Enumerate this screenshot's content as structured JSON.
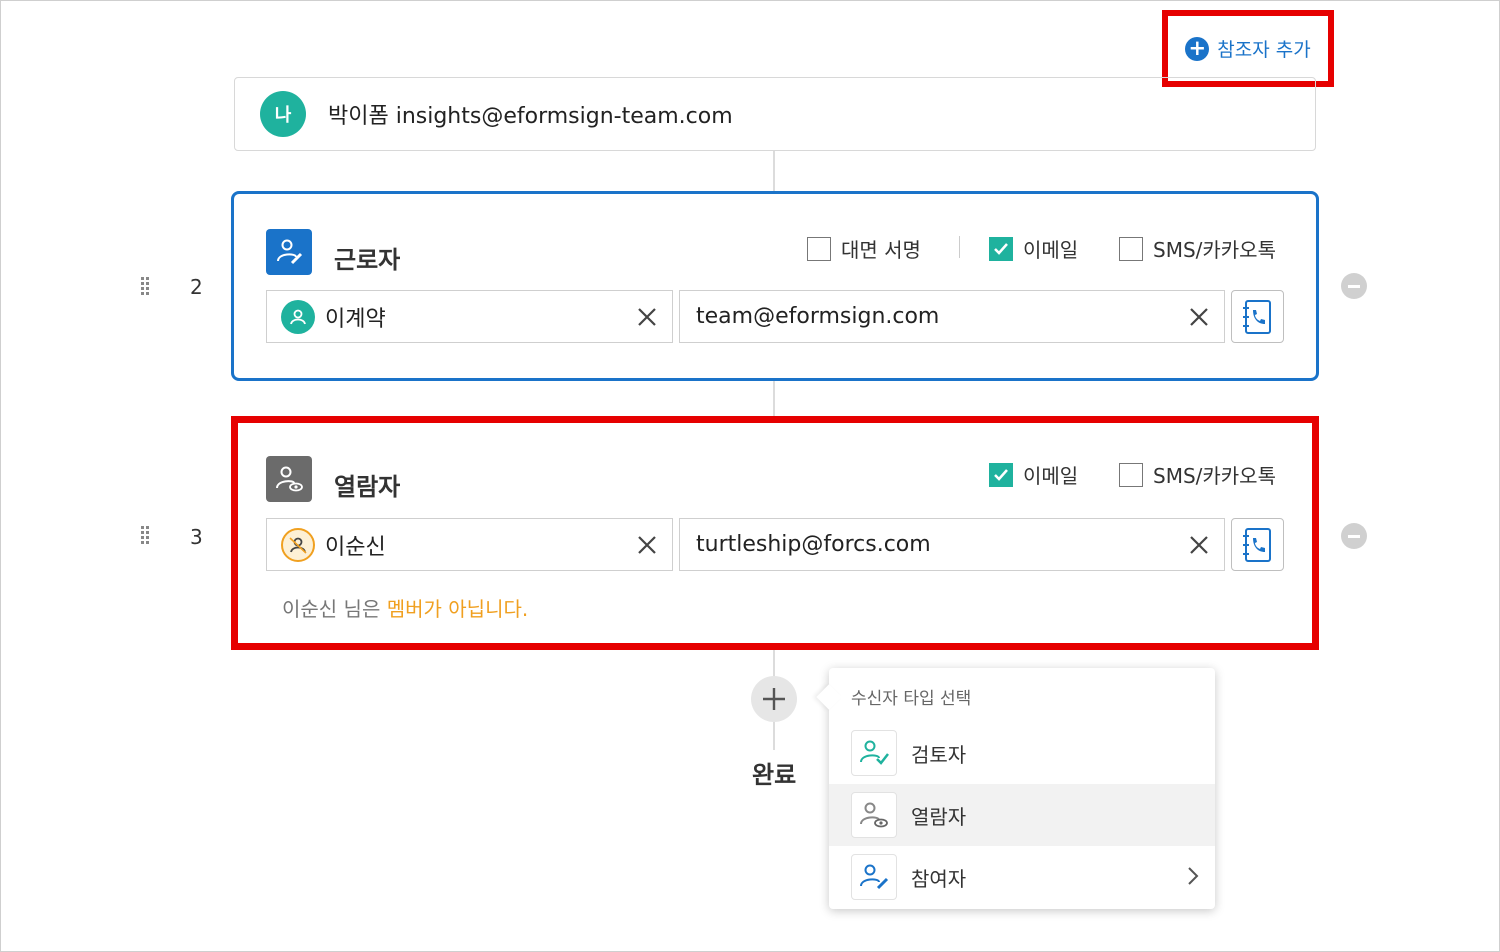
{
  "header": {
    "add_participant_label": "참조자 추가"
  },
  "me": {
    "badge": "나",
    "text": "박이폼 insights@eformsign-team.com"
  },
  "steps": [
    {
      "number": "2",
      "role": "근로자",
      "options": [
        {
          "label": "대면 서명",
          "checked": false
        },
        {
          "label": "이메일",
          "checked": true
        },
        {
          "label": "SMS/카카오톡",
          "checked": false
        }
      ],
      "name": "이계약",
      "email": "team@eformsign.com"
    },
    {
      "number": "3",
      "role": "열람자",
      "options": [
        {
          "label": "이메일",
          "checked": true
        },
        {
          "label": "SMS/카카오톡",
          "checked": false
        }
      ],
      "name": "이순신",
      "email": "turtleship@forcs.com",
      "warning_prefix": "이순신 님은 ",
      "warning_highlight": "멤버가 아닙니다."
    }
  ],
  "done_label": "완료",
  "recipient_menu": {
    "title": "수신자 타입 선택",
    "items": [
      {
        "label": "검토자",
        "icon": "reviewer-icon",
        "selected": false
      },
      {
        "label": "열람자",
        "icon": "viewer-icon",
        "selected": true
      },
      {
        "label": "참여자",
        "icon": "participant-icon",
        "selected": false,
        "has_submenu": true
      }
    ]
  },
  "colors": {
    "accent_blue": "#1a73c9",
    "teal": "#1fb29e",
    "highlight_red": "#e60000",
    "warning_orange": "#f0a020"
  }
}
